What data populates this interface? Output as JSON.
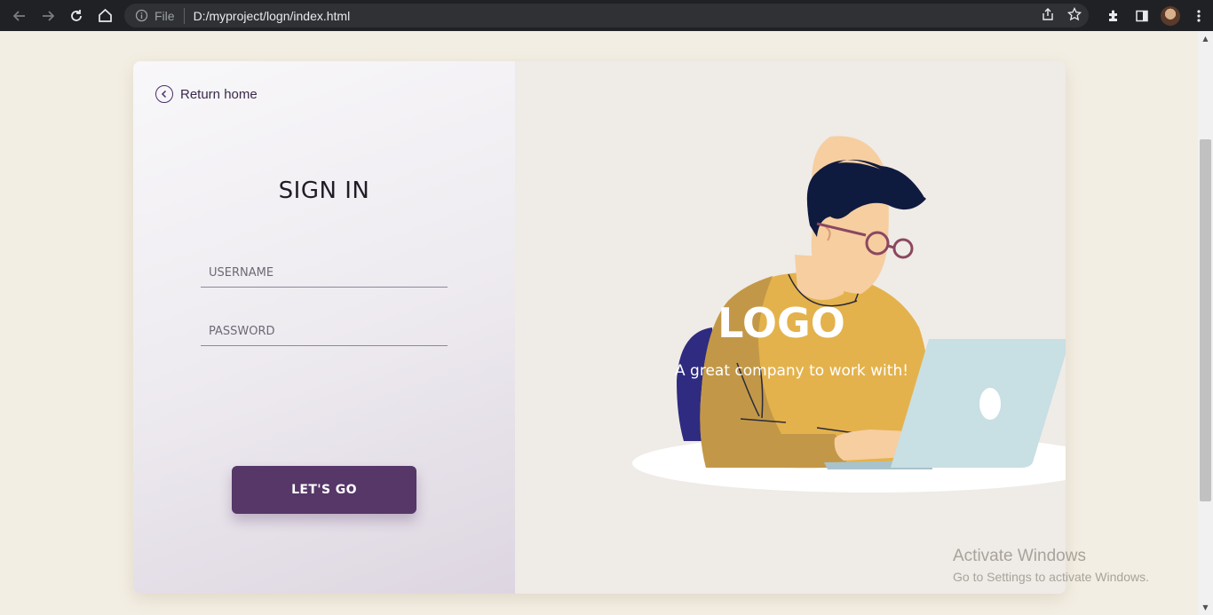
{
  "browser": {
    "scheme_label": "File",
    "url": "D:/myproject/logn/index.html",
    "icons": [
      "back-icon",
      "forward-icon",
      "reload-icon",
      "home-icon",
      "info-icon",
      "share-icon",
      "star-icon",
      "extensions-icon",
      "side-panel-icon",
      "profile-avatar",
      "menu-icon"
    ]
  },
  "login": {
    "return_label": "Return home",
    "title": "SIGN IN",
    "username_placeholder": "USERNAME",
    "password_placeholder": "PASSWORD",
    "submit_label": "LET'S GO"
  },
  "brand": {
    "logo": "LOGO",
    "tagline": "A great company to work with!"
  },
  "os_watermark": {
    "line1": "Activate Windows",
    "line2": "Go to Settings to activate Windows."
  },
  "colors": {
    "accent": "#563768",
    "page_background": "#f3eee3",
    "panel_background": "#efebe7"
  }
}
